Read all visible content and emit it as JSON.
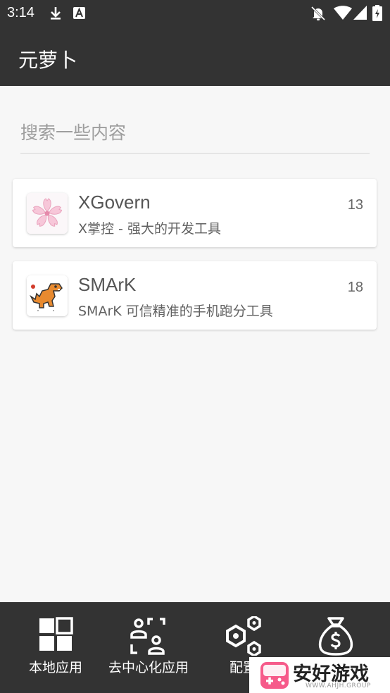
{
  "status_bar": {
    "time": "3:14",
    "icons": [
      "download-icon",
      "a-notification-icon",
      "bell-off-icon",
      "wifi-icon",
      "signal-icon",
      "battery-icon"
    ]
  },
  "app_bar": {
    "title": "元萝卜"
  },
  "search": {
    "placeholder": "搜索一些内容",
    "value": ""
  },
  "apps": [
    {
      "name": "XGovern",
      "description": "X掌控 - 强大的开发工具",
      "count": "13",
      "icon": "sakura-flower-icon"
    },
    {
      "name": "SMArK",
      "description": "SMArK 可信精准的手机跑分工具",
      "count": "18",
      "icon": "orange-dinosaur-icon"
    }
  ],
  "bottom_nav": [
    {
      "label": "本地应用",
      "icon": "grid-apps-icon"
    },
    {
      "label": "去中心化应用",
      "icon": "decentralized-users-icon"
    },
    {
      "label": "配置",
      "icon": "hexagon-nodes-icon"
    },
    {
      "label": "",
      "icon": "money-bag-icon"
    }
  ],
  "watermark": {
    "text": "安好游戏",
    "sub": "WWW.AHJH.GROUP"
  },
  "colors": {
    "bar": "#333333",
    "background": "#f7f7f7",
    "card": "#ffffff"
  }
}
